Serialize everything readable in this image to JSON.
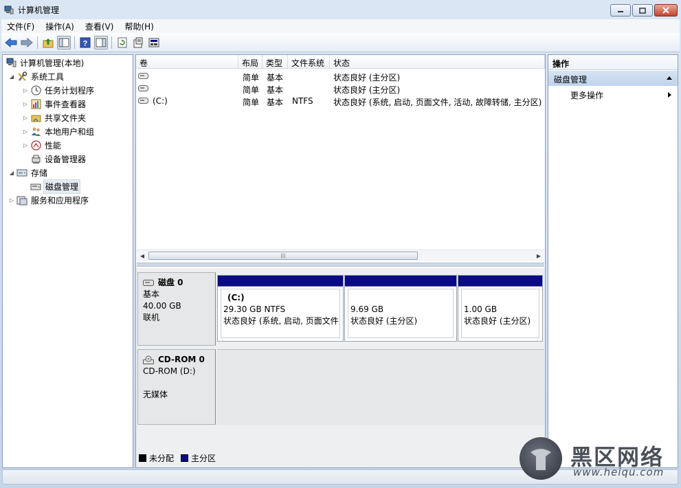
{
  "window": {
    "title": "计算机管理"
  },
  "menu": [
    "文件(F)",
    "操作(A)",
    "查看(V)",
    "帮助(H)"
  ],
  "tree": {
    "root": "计算机管理(本地)",
    "system_tools": "系统工具",
    "task_scheduler": "任务计划程序",
    "event_viewer": "事件查看器",
    "shared_folders": "共享文件夹",
    "local_users": "本地用户和组",
    "performance": "性能",
    "device_manager": "设备管理器",
    "storage": "存储",
    "disk_management": "磁盘管理",
    "services_apps": "服务和应用程序"
  },
  "volume_list": {
    "columns": [
      "卷",
      "布局",
      "类型",
      "文件系统",
      "状态"
    ],
    "rows": [
      {
        "volume": "",
        "layout": "简单",
        "type": "基本",
        "fs": "",
        "status": "状态良好 (主分区)"
      },
      {
        "volume": "",
        "layout": "简单",
        "type": "基本",
        "fs": "",
        "status": "状态良好 (主分区)"
      },
      {
        "volume": "(C:)",
        "layout": "简单",
        "type": "基本",
        "fs": "NTFS",
        "status": "状态良好 (系统, 启动, 页面文件, 活动, 故障转储, 主分区)"
      }
    ]
  },
  "disk0": {
    "name": "磁盘 0",
    "type": "基本",
    "size": "40.00 GB",
    "state": "联机",
    "partitions": [
      {
        "label": "(C:)",
        "size": "29.30 GB NTFS",
        "status": "状态良好 (系统, 启动, 页面文件,"
      },
      {
        "label": "",
        "size": "9.69 GB",
        "status": "状态良好 (主分区)"
      },
      {
        "label": "",
        "size": "1.00 GB",
        "status": "状态良好 (主分区)"
      }
    ]
  },
  "cdrom0": {
    "name": "CD-ROM 0",
    "drive": "CD-ROM (D:)",
    "media": "无媒体"
  },
  "legend": {
    "unallocated": "未分配",
    "primary": "主分区"
  },
  "actions": {
    "header": "操作",
    "group": "磁盘管理",
    "more": "更多操作"
  },
  "watermark": {
    "title": "黑区网络",
    "url": "www.heiqu.com"
  },
  "colors": {
    "primary_partition": "#0a0a87",
    "unallocated": "#000000"
  }
}
